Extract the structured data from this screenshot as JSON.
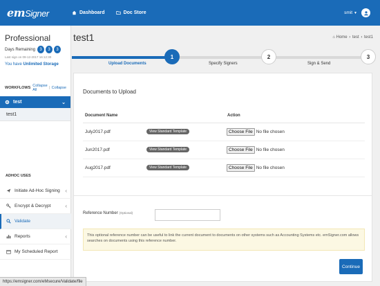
{
  "header": {
    "logo_main": "em",
    "logo_sub": "Signer",
    "nav": [
      {
        "label": "Dashboard",
        "icon": "home-icon"
      },
      {
        "label": "Doc Store",
        "icon": "folder-icon"
      }
    ],
    "user_label": "smit"
  },
  "sidebar": {
    "plan_title": "Professional",
    "days_label": "Days Remaining",
    "days_digits": [
      "3",
      "3",
      "3"
    ],
    "last_signin": "Last sign on 09-12-2017 16:12:30",
    "storage_prefix": "You have",
    "storage_value": "Unlimited Storage",
    "workflows_title": "WORKFLOWS",
    "collapse_all": "Collapse All",
    "collapse": "Collapse",
    "workflow_active": "test",
    "workflow_sub": "test1",
    "adhoc_title": "ADHOC USES",
    "menu": [
      {
        "label": "Initiate Ad-Hoc Signing",
        "icon": "send-icon"
      },
      {
        "label": "Encrypt & Decrypt",
        "icon": "key-icon"
      },
      {
        "label": "Validate",
        "icon": "search-icon"
      },
      {
        "label": "Reports",
        "icon": "bar-chart-icon"
      },
      {
        "label": "My Scheduled Report",
        "icon": "calendar-icon"
      }
    ]
  },
  "main": {
    "title": "test1",
    "breadcrumb": [
      "Home",
      "test",
      "test1"
    ],
    "steps": [
      {
        "num": "1",
        "label": "Upload Documents",
        "active": true
      },
      {
        "num": "2",
        "label": "Specify Signers",
        "active": false
      },
      {
        "num": "3",
        "label": "Sign & Send",
        "active": false
      }
    ],
    "card_title": "Documents to Upload",
    "col_name": "Document Name",
    "col_action": "Action",
    "rows": [
      {
        "name": "July2017.pdf",
        "template": "View Standard Template",
        "choose": "Choose File",
        "nofile": "No file chosen"
      },
      {
        "name": "Jun2017.pdf",
        "template": "View Standard Template",
        "choose": "Choose File",
        "nofile": "No file chosen"
      },
      {
        "name": "Aug2017.pdf",
        "template": "View Standard Template",
        "choose": "Choose File",
        "nofile": "No file chosen"
      }
    ],
    "ref_label": "Reference Number",
    "ref_optional": "(Optional)",
    "ref_value": "",
    "note": "This optional reference number can be useful to link the current document to documents on other systems such as Accounting Systems etc. emSigner.com allows searches on documents using this reference number.",
    "continue_label": "Continue"
  },
  "statusbar": {
    "url": "https://emsigner.com/eMsecure/Validate/file"
  },
  "colors": {
    "primary": "#1a6bb8",
    "note_bg": "#fcf8e3"
  }
}
